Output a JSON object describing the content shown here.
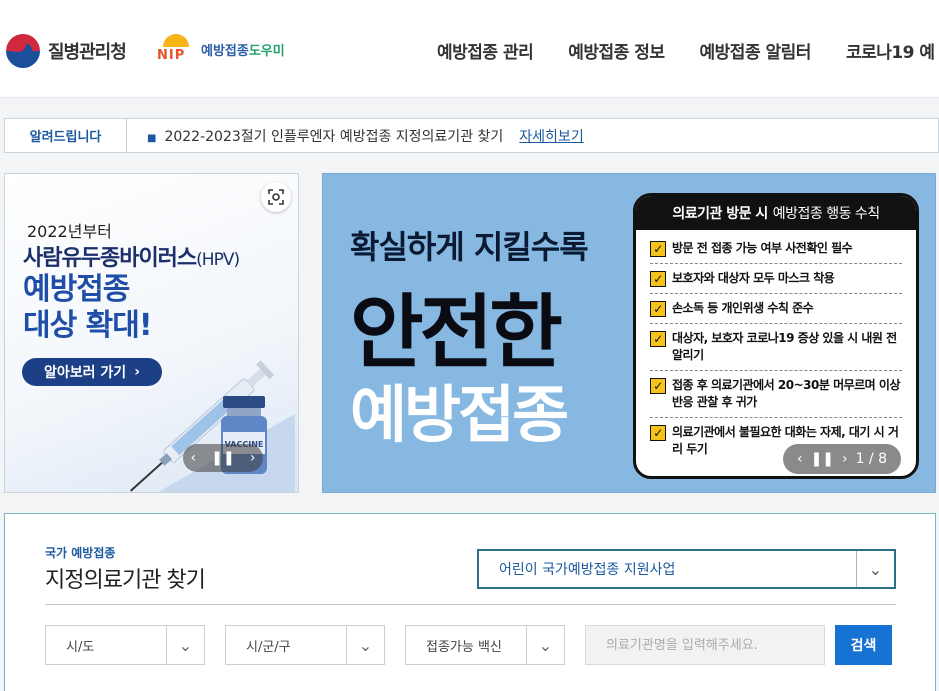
{
  "header": {
    "org_name": "질병관리청",
    "nip_letters": "NIP",
    "nip_name_a": "예방접종",
    "nip_name_b": "도우미",
    "nav": [
      "예방접종 관리",
      "예방접종 정보",
      "예방접종 알림터",
      "코로나19 예"
    ]
  },
  "notice": {
    "label": "알려드립니다",
    "text": "2022-2023절기 인플루엔자 예방접종 지정의료기관 찾기",
    "link": "자세히보기"
  },
  "banner_left": {
    "year": "2022년부터",
    "hpv": "사람유두종바이러스",
    "hpv_suffix": "(HPV)",
    "title_line1": "예방접종",
    "title_line2": "대상 확대!",
    "button": "알아보러 가기",
    "vial_label": "VACCINE"
  },
  "banner_right": {
    "subtitle": "확실하게 지킬수록",
    "big": "안전한",
    "white": "예방접종",
    "rules_head_bold": "의료기관 방문 시",
    "rules_head_rest": "예방접종 행동 수칙",
    "rules": [
      "방문 전 접종 가능 여부 사전확인 필수",
      "보호자와 대상자 모두 마스크 착용",
      "손소독 등 개인위생 수칙 준수",
      "대상자, 보호자 코로나19 증상 있을 시 내원 전 알리기",
      "접종 후 의료기관에서 20~30분 머무르며 이상반응 관찰 후 귀가",
      "의료기관에서 불필요한 대화는 자제, 대기 시 거리 두기"
    ],
    "counter": "1 / 8"
  },
  "search": {
    "small_label": "국가 예방접종",
    "title": "지정의료기관 찾기",
    "program": "어린이 국가예방접종 지원사업",
    "sido": "시/도",
    "sigungu": "시/군/구",
    "vaccine": "접종가능 백신",
    "placeholder": "의료기관명을 입력해주세요.",
    "button": "검색"
  },
  "colors": {
    "brand_blue": "#1b5aa0",
    "banner_blue": "#87b8e2",
    "search_button": "#1673d4",
    "check_yellow": "#f7c21a"
  }
}
